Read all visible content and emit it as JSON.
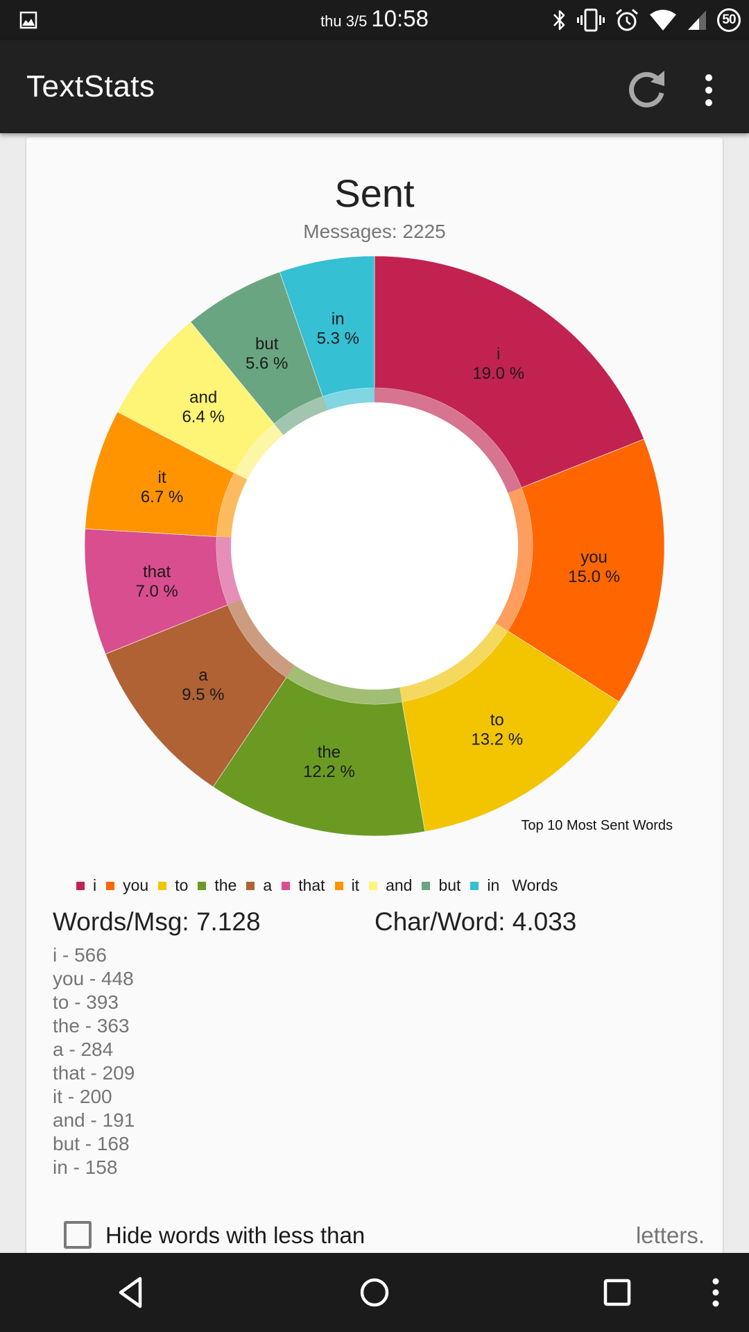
{
  "status_bar": {
    "date": "thu 3/5",
    "time": "10:58",
    "battery": "50",
    "icons": [
      "gallery-icon",
      "bluetooth-icon",
      "vibrate-icon",
      "alarm-icon",
      "wifi-icon",
      "cell-signal-icon",
      "battery-icon"
    ]
  },
  "app_bar": {
    "title": "TextStats",
    "actions": [
      "refresh-icon",
      "overflow-menu-icon"
    ]
  },
  "card": {
    "title": "Sent",
    "subtitle": "Messages: 2225",
    "words_per_msg": "Words/Msg: 7.128",
    "char_per_word": "Char/Word: 4.033",
    "word_counts": [
      "i - 566",
      "you - 448",
      "to - 393",
      "the - 363",
      "a - 284",
      "that - 209",
      "it - 200",
      "and - 191",
      "but - 168",
      "in - 158"
    ],
    "hide_words": {
      "checked": false,
      "label": "Hide words with less than",
      "suffix": "letters."
    }
  },
  "chart_data": {
    "type": "pie",
    "variant": "donut",
    "title": "Sent",
    "subtitle": "Messages: 2225",
    "description": "Top 10 Most Sent Words",
    "legend_title": "Words",
    "legend_position": "bottom-left",
    "start_angle": "top, clockwise",
    "categories": [
      "i",
      "you",
      "to",
      "the",
      "a",
      "that",
      "it",
      "and",
      "but",
      "in"
    ],
    "values": [
      566,
      448,
      393,
      363,
      284,
      209,
      200,
      191,
      168,
      158
    ],
    "percent_labels": [
      "19.0 %",
      "15.0 %",
      "13.2 %",
      "12.2 %",
      "9.5 %",
      "7.0 %",
      "6.7 %",
      "6.4 %",
      "5.6 %",
      "5.3 %"
    ],
    "colors": [
      "#C2224F",
      "#FF6600",
      "#F2C500",
      "#6A9A22",
      "#B06235",
      "#D94E8F",
      "#FF9400",
      "#FEF475",
      "#6AA581",
      "#35C0D3"
    ]
  },
  "nav_bar": {
    "buttons": [
      "back-icon",
      "home-icon",
      "recents-icon",
      "menu-icon"
    ]
  }
}
